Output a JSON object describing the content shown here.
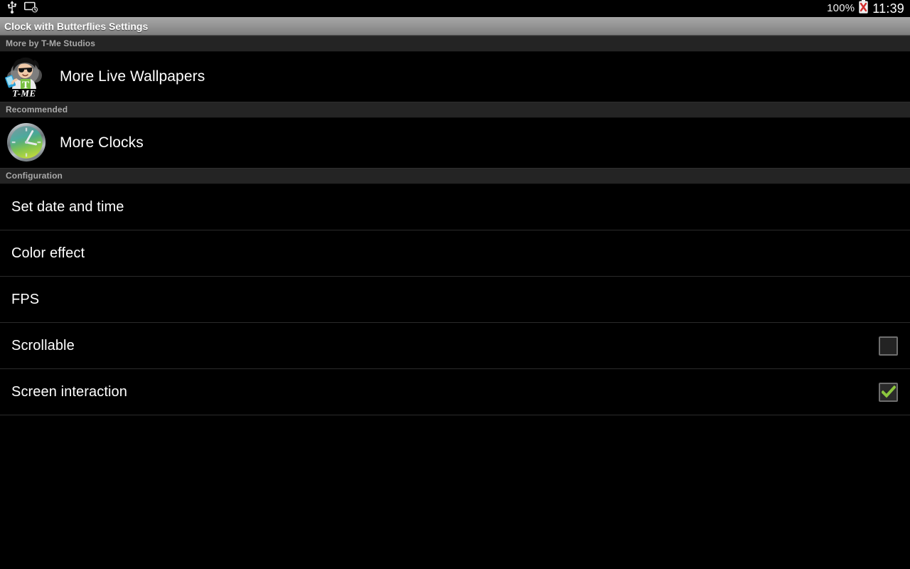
{
  "statusbar": {
    "icons": [
      {
        "name": "usb-icon",
        "label": "USB"
      },
      {
        "name": "screenshot-clock-icon",
        "label": "Screen timer"
      }
    ],
    "battery_percent": "100%",
    "battery_icon": "battery-error-icon",
    "clock": "11:39",
    "background_color": "#000000",
    "text_color": "#ffffff"
  },
  "titlebar": {
    "title": "Clock with Butterflies Settings",
    "background_start": "#a6a6a6",
    "background_end": "#7e7e7e",
    "text_color": "#ffffff"
  },
  "sections": [
    {
      "header": "More by T-Me Studios",
      "items": [
        {
          "label": "More Live Wallpapers",
          "icon": "t-me-studios-logo-icon",
          "type": "link",
          "has_checkbox": false
        }
      ]
    },
    {
      "header": "Recommended",
      "items": [
        {
          "label": "More Clocks",
          "icon": "analog-clock-icon",
          "type": "link",
          "has_checkbox": false
        }
      ]
    },
    {
      "header": "Configuration",
      "items": [
        {
          "label": "Set date and time",
          "icon": "",
          "type": "preference",
          "has_checkbox": false
        },
        {
          "label": "Color effect",
          "icon": "",
          "type": "preference",
          "has_checkbox": false
        },
        {
          "label": "FPS",
          "icon": "",
          "type": "preference",
          "has_checkbox": false
        },
        {
          "label": "Scrollable",
          "icon": "",
          "type": "checkbox-preference",
          "has_checkbox": true,
          "checked": false
        },
        {
          "label": "Screen interaction",
          "icon": "",
          "type": "checkbox-preference",
          "has_checkbox": true,
          "checked": true
        }
      ]
    }
  ],
  "theme": {
    "background": "#000000",
    "section_header_bg": "#242424",
    "section_header_text": "#a9a9a9",
    "row_text": "#ffffff",
    "divider": "#2b2b2b",
    "checkbox_border": "#6e6e6e",
    "checkbox_check": "#8cc63e",
    "battery_error": "#d32f2f"
  }
}
